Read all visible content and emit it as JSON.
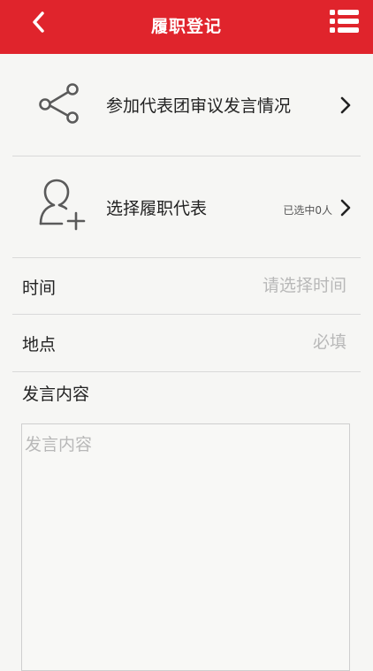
{
  "header": {
    "title": "履职登记",
    "back_icon": "chevron-left-icon",
    "menu_icon": "list-menu-icon",
    "background_color": "#e0242c"
  },
  "rows": {
    "speech": {
      "label": "参加代表团审议发言情况",
      "icon": "share-icon"
    },
    "delegate": {
      "label": "选择履职代表",
      "icon": "add-user-icon",
      "selected_count_text": "已选中0人"
    }
  },
  "fields": {
    "time": {
      "label": "时间",
      "placeholder": "请选择时间"
    },
    "location": {
      "label": "地点",
      "placeholder": "必填"
    },
    "content": {
      "label": "发言内容",
      "placeholder": "发言内容"
    }
  }
}
